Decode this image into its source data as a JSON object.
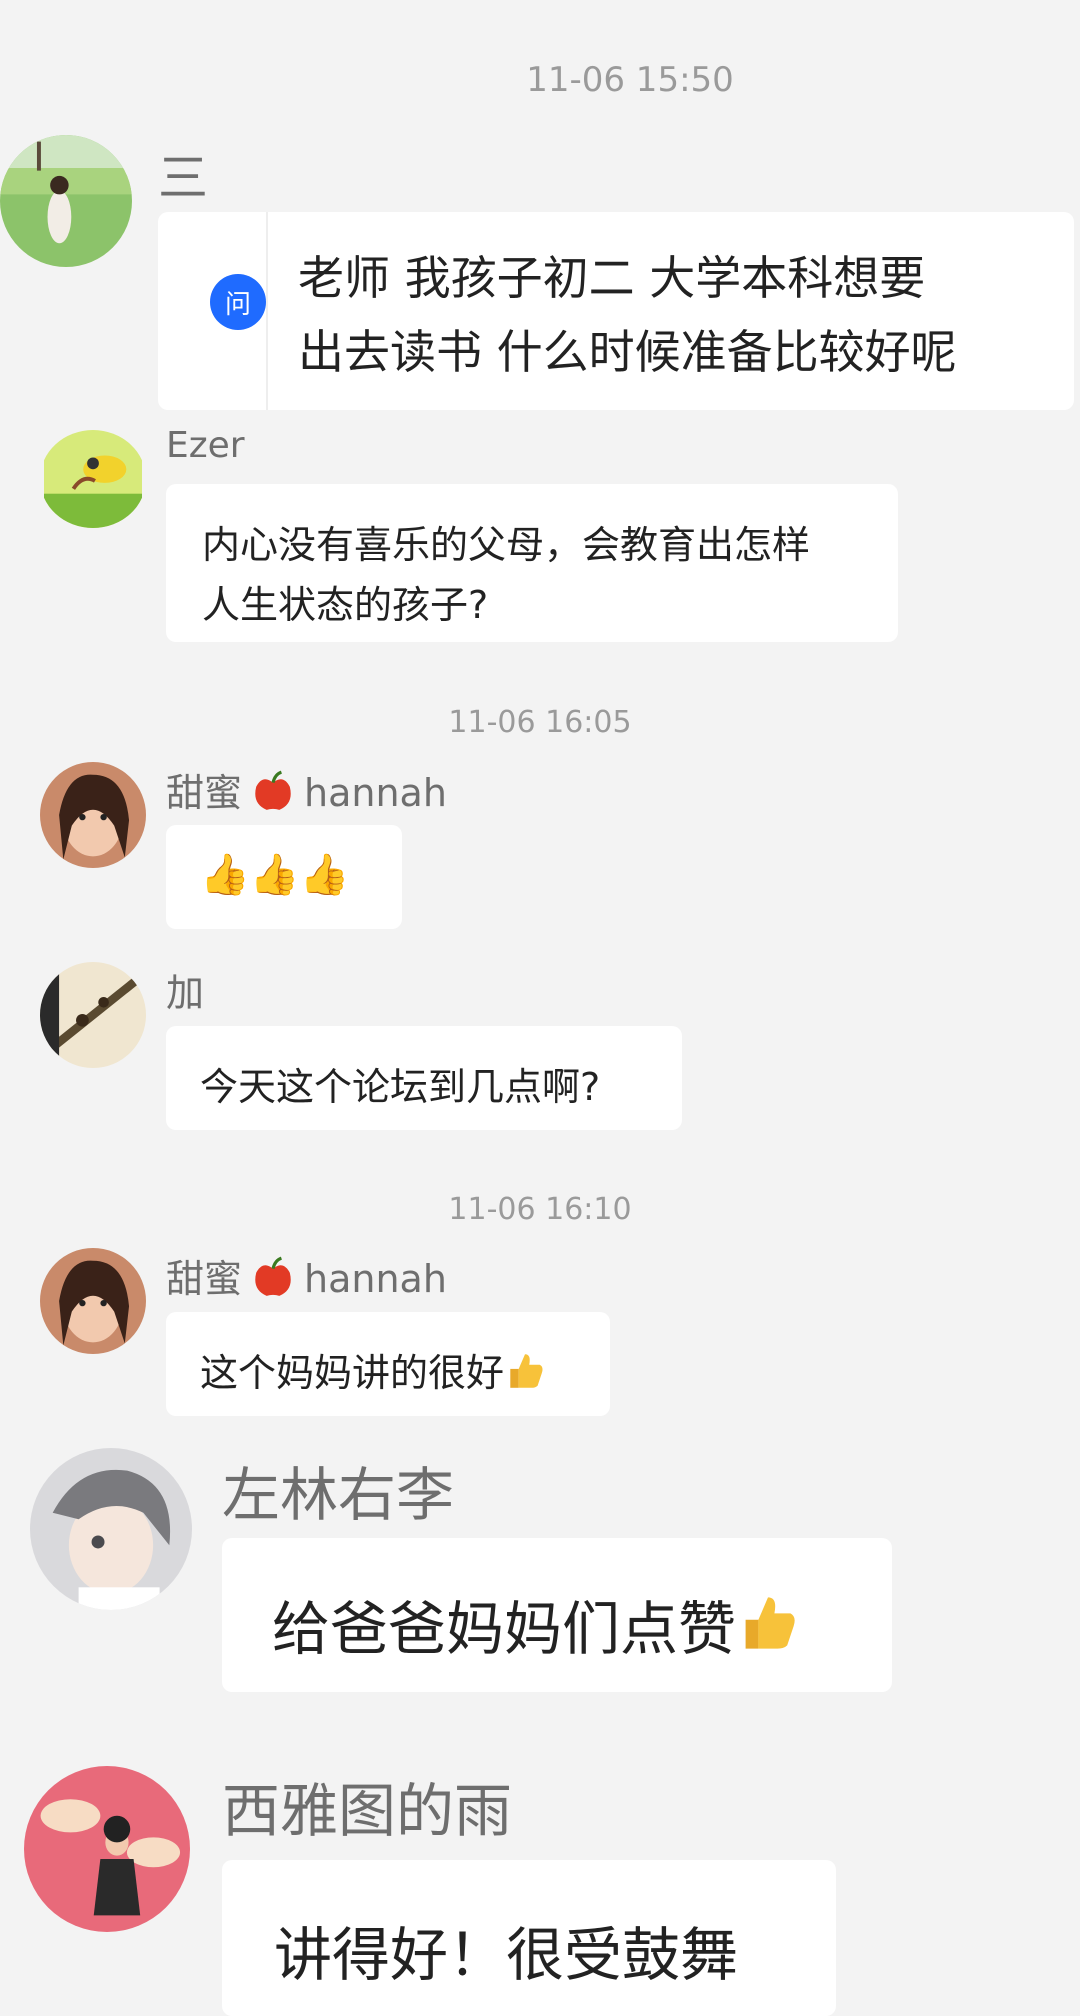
{
  "timestamps": [
    "11-06 15:50",
    "11-06 16:05",
    "11-06 16:10"
  ],
  "messages": [
    {
      "name": "三",
      "badge": "问",
      "text_line1": "老师 我孩子初二 大学本科想要",
      "text_line2": "出去读书 什么时候准备比较好呢",
      "avatar": "field-person-avatar"
    },
    {
      "name": "Ezer",
      "text_line1": "内心没有喜乐的父母，会教育出怎样",
      "text_line2": "人生状态的孩子?",
      "avatar": "bird-avatar"
    },
    {
      "name_prefix": "甜蜜",
      "name_suffix": "hannah",
      "name_emoji": "apple-icon",
      "text": "👍👍👍",
      "avatar": "girl-avatar"
    },
    {
      "name": "加",
      "text": "今天这个论坛到几点啊?",
      "avatar": "branch-avatar"
    },
    {
      "name_prefix": "甜蜜",
      "name_suffix": "hannah",
      "name_emoji": "apple-icon",
      "text": "这个妈妈讲的很好",
      "text_emoji": "thumbs-up-icon",
      "avatar": "girl-avatar"
    },
    {
      "name": "左林右李",
      "text": "给爸爸妈妈们点赞",
      "text_emoji": "thumbs-up-icon",
      "avatar": "anime-girl-avatar"
    },
    {
      "name": "西雅图的雨",
      "text": "讲得好！很受鼓舞",
      "avatar": "pink-photo-avatar"
    }
  ],
  "colors": {
    "background": "#f3f3f3",
    "bubble": "#ffffff",
    "badge": "#1f6bff",
    "name": "#6e6e6e",
    "timestamp": "#9a9a9a"
  }
}
